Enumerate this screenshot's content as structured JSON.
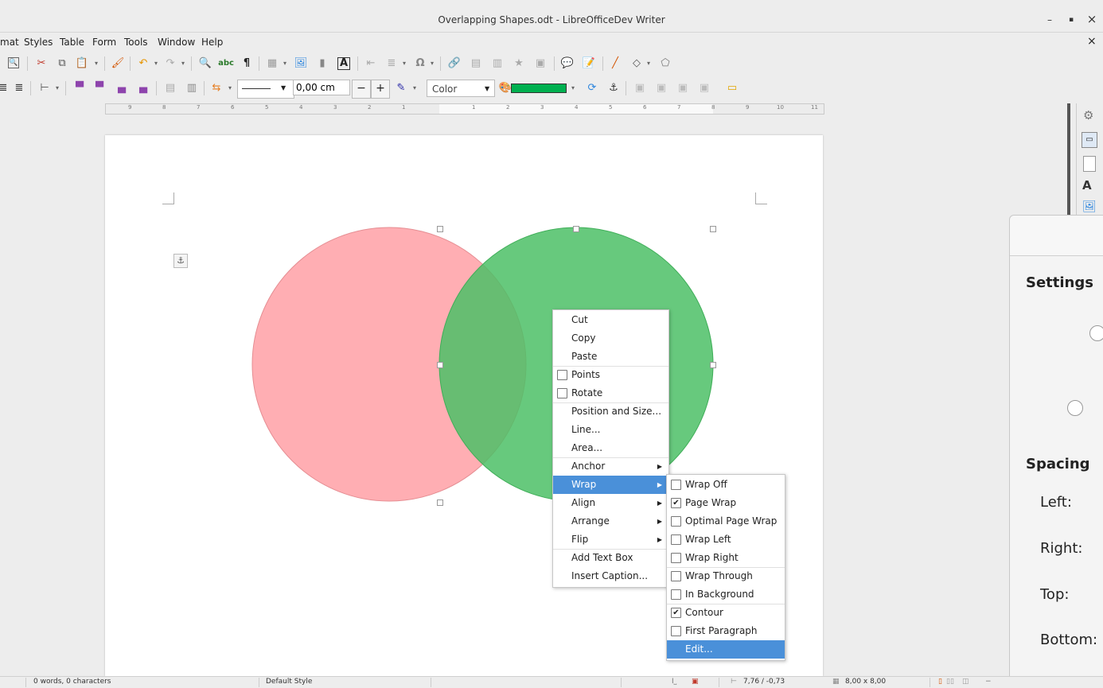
{
  "window": {
    "title": "Overlapping Shapes.odt - LibreOfficeDev Writer",
    "minimize": "–",
    "maximize": "▪",
    "close": "×",
    "doc_close": "×"
  },
  "menubar": [
    "mat",
    "Styles",
    "Table",
    "Form",
    "Tools",
    "Window",
    "Help"
  ],
  "toolbar2": {
    "line_width_value": "0,00 cm",
    "minus": "−",
    "plus": "+",
    "area_style": "Color"
  },
  "ruler": [
    "9",
    "8",
    "7",
    "6",
    "5",
    "4",
    "3",
    "2",
    "1",
    "1",
    "2",
    "3",
    "4",
    "5",
    "6",
    "7",
    "8",
    "9",
    "10",
    "11"
  ],
  "shapes": {
    "circle1_color": "#ff9aa0",
    "circle2_color": "#4cbf66",
    "overlap_color": "#5aa65e"
  },
  "context_menu": {
    "cut": "Cut",
    "copy": "Copy",
    "paste": "Paste",
    "points": "Points",
    "rotate": "Rotate",
    "position_size": "Position and Size...",
    "line": "Line...",
    "area": "Area...",
    "anchor": "Anchor",
    "wrap": "Wrap",
    "align": "Align",
    "arrange": "Arrange",
    "flip": "Flip",
    "add_text_box": "Add Text Box",
    "insert_caption": "Insert Caption..."
  },
  "wrap_submenu": {
    "wrap_off": "Wrap Off",
    "page_wrap": "Page Wrap",
    "optimal_page_wrap": "Optimal Page Wrap",
    "wrap_left": "Wrap Left",
    "wrap_right": "Wrap Right",
    "wrap_through": "Wrap Through",
    "in_background": "In Background",
    "contour": "Contour",
    "first_paragraph": "First Paragraph",
    "edit": "Edit..."
  },
  "side_dialog": {
    "settings": "Settings",
    "spacing": "Spacing",
    "left": "Left:",
    "right": "Right:",
    "top": "Top:",
    "bottom": "Bottom:"
  },
  "statusbar": {
    "word_count": "0 words, 0 characters",
    "page_style": "Default Style",
    "position": "7,76 / -0,73",
    "size": "8,00 x 8,00"
  },
  "colors": {
    "highlight": "#4a90d9",
    "line_color_swatch": "#00b050"
  }
}
